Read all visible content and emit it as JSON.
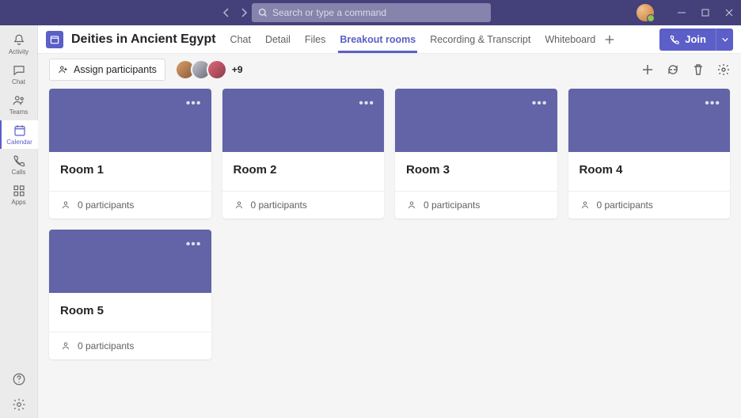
{
  "search": {
    "placeholder": "Search or type a command"
  },
  "leftnav": {
    "items": [
      {
        "label": "Activity"
      },
      {
        "label": "Chat"
      },
      {
        "label": "Teams"
      },
      {
        "label": "Calendar"
      },
      {
        "label": "Calls"
      },
      {
        "label": "Apps"
      }
    ],
    "active_index": 3
  },
  "meeting": {
    "title": "Deities in Ancient Egypt",
    "join_label": "Join"
  },
  "tabs": {
    "items": [
      "Chat",
      "Detail",
      "Files",
      "Breakout rooms",
      "Recording & Transcript",
      "Whiteboard"
    ],
    "active_index": 3
  },
  "subbar": {
    "assign_label": "Assign participants",
    "overflow_count": "+9"
  },
  "rooms": [
    {
      "name": "Room 1",
      "participants_label": "0 participants"
    },
    {
      "name": "Room 2",
      "participants_label": "0 participants"
    },
    {
      "name": "Room 3",
      "participants_label": "0 participants"
    },
    {
      "name": "Room 4",
      "participants_label": "0 participants"
    },
    {
      "name": "Room 5",
      "participants_label": "0 participants"
    }
  ]
}
